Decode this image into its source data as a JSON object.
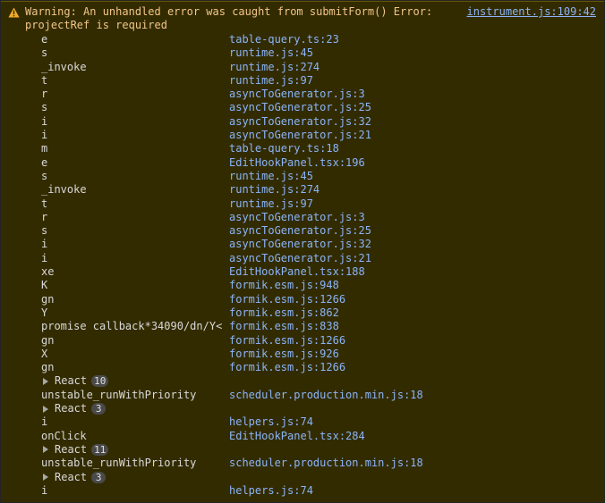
{
  "warning": {
    "icon": "warning-triangle-icon",
    "message": "Warning: An unhandled error was caught from submitForm() Error: projectRef is required",
    "source": "instrument.js:109:42"
  },
  "frames": [
    {
      "kind": "frame",
      "fn": "e",
      "loc": "table-query.ts:23"
    },
    {
      "kind": "frame",
      "fn": "s",
      "loc": "runtime.js:45"
    },
    {
      "kind": "frame",
      "fn": "_invoke",
      "loc": "runtime.js:274"
    },
    {
      "kind": "frame",
      "fn": "t",
      "loc": "runtime.js:97"
    },
    {
      "kind": "frame",
      "fn": "r",
      "loc": "asyncToGenerator.js:3"
    },
    {
      "kind": "frame",
      "fn": "s",
      "loc": "asyncToGenerator.js:25"
    },
    {
      "kind": "frame",
      "fn": "i",
      "loc": "asyncToGenerator.js:32"
    },
    {
      "kind": "frame",
      "fn": "i",
      "loc": "asyncToGenerator.js:21"
    },
    {
      "kind": "frame",
      "fn": "m",
      "loc": "table-query.ts:18"
    },
    {
      "kind": "frame",
      "fn": "e",
      "loc": "EditHookPanel.tsx:196"
    },
    {
      "kind": "frame",
      "fn": "s",
      "loc": "runtime.js:45"
    },
    {
      "kind": "frame",
      "fn": "_invoke",
      "loc": "runtime.js:274"
    },
    {
      "kind": "frame",
      "fn": "t",
      "loc": "runtime.js:97"
    },
    {
      "kind": "frame",
      "fn": "r",
      "loc": "asyncToGenerator.js:3"
    },
    {
      "kind": "frame",
      "fn": "s",
      "loc": "asyncToGenerator.js:25"
    },
    {
      "kind": "frame",
      "fn": "i",
      "loc": "asyncToGenerator.js:32"
    },
    {
      "kind": "frame",
      "fn": "i",
      "loc": "asyncToGenerator.js:21"
    },
    {
      "kind": "frame",
      "fn": "xe",
      "loc": "EditHookPanel.tsx:188"
    },
    {
      "kind": "frame",
      "fn": "K",
      "loc": "formik.esm.js:948"
    },
    {
      "kind": "frame",
      "fn": "gn",
      "loc": "formik.esm.js:1266"
    },
    {
      "kind": "frame",
      "fn": "Y",
      "loc": "formik.esm.js:862"
    },
    {
      "kind": "frame",
      "fn": "promise callback*34090/dn/Y<",
      "loc": "formik.esm.js:838"
    },
    {
      "kind": "frame",
      "fn": "gn",
      "loc": "formik.esm.js:1266"
    },
    {
      "kind": "frame",
      "fn": "X",
      "loc": "formik.esm.js:926"
    },
    {
      "kind": "frame",
      "fn": "gn",
      "loc": "formik.esm.js:1266"
    },
    {
      "kind": "group",
      "label": "React",
      "count": "10"
    },
    {
      "kind": "frame",
      "fn": "unstable_runWithPriority",
      "loc": "scheduler.production.min.js:18"
    },
    {
      "kind": "group",
      "label": "React",
      "count": "3"
    },
    {
      "kind": "frame",
      "fn": "i",
      "loc": "helpers.js:74"
    },
    {
      "kind": "frame",
      "fn": "onClick",
      "loc": "EditHookPanel.tsx:284"
    },
    {
      "kind": "group",
      "label": "React",
      "count": "11"
    },
    {
      "kind": "frame",
      "fn": "unstable_runWithPriority",
      "loc": "scheduler.production.min.js:18"
    },
    {
      "kind": "group",
      "label": "React",
      "count": "3"
    },
    {
      "kind": "frame",
      "fn": "i",
      "loc": "helpers.js:74"
    }
  ]
}
